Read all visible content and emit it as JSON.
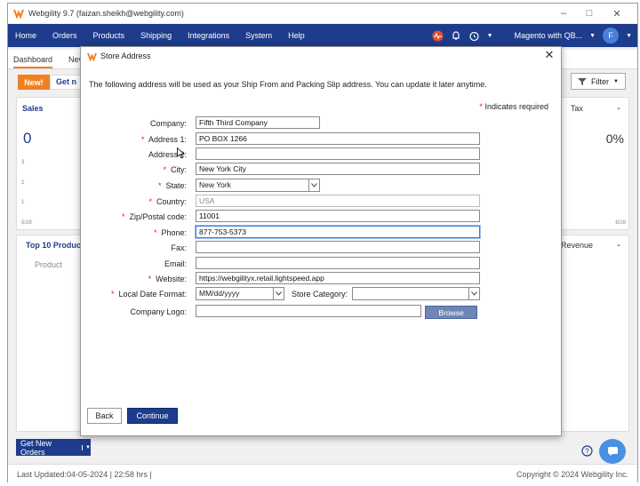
{
  "app": {
    "title": "Webgility 9.7 (faizan.sheikh@webgility.com)"
  },
  "nav": {
    "items": [
      "Home",
      "Orders",
      "Products",
      "Shipping",
      "Integrations",
      "System",
      "Help"
    ],
    "account": "Magento with QB...",
    "avatar_letter": "F"
  },
  "tabs": {
    "dashboard": "Dashboard",
    "partial": "Nev"
  },
  "toolbar": {
    "new_label": "New!",
    "get_label": "Get n",
    "filter_label": "Filter"
  },
  "sales": {
    "title": "Sales",
    "value": "0",
    "y_ticks": [
      "3",
      "2",
      "1"
    ],
    "x_start": "5/28",
    "x_end": "6/28"
  },
  "tax": {
    "title": "Tax",
    "value": "0%"
  },
  "top_products": {
    "title": "Top 10 Produc",
    "column": "Product",
    "right_label": "Revenue"
  },
  "get_new_orders": {
    "label": "Get New Orders"
  },
  "footer": {
    "last_updated": "Last Updated:04-05-2024 | 22:58 hrs |",
    "copyright": "Copyright © 2024 Webgility Inc."
  },
  "dialog": {
    "title": "Store Address",
    "intro": "The following address will be used as your Ship From and Packing Slip address. You can update it later anytime.",
    "required_note": "Indicates required",
    "required_mark": "*",
    "fields": {
      "company": {
        "label": "Company:",
        "value": "Fifth Third Company"
      },
      "address1": {
        "label": "Address 1:",
        "value": "PO BOX 1266"
      },
      "address2": {
        "label": "Address 2:",
        "value": ""
      },
      "city": {
        "label": "City:",
        "value": "New York City"
      },
      "state": {
        "label": "State:",
        "value": "New York"
      },
      "country": {
        "label": "Country:",
        "value": "USA"
      },
      "zip": {
        "label": "Zip/Postal code:",
        "value": "11001"
      },
      "phone": {
        "label": "Phone:",
        "value": "877-753-5373"
      },
      "fax": {
        "label": "Fax:",
        "value": ""
      },
      "email": {
        "label": "Email:",
        "value": ""
      },
      "website": {
        "label": "Website:",
        "value": "https://webgilityx.retail.lightspeed.app"
      },
      "date_format": {
        "label": "Local Date Format:",
        "value": "MM/dd/yyyy"
      },
      "store_category": {
        "label": "Store Category:",
        "value": ""
      },
      "logo": {
        "label": "Company Logo:",
        "value": ""
      }
    },
    "browse_label": "Browse",
    "back_label": "Back",
    "continue_label": "Continue"
  },
  "colors": {
    "nav_bg": "#1e3c8c",
    "accent_orange": "#f08020",
    "required_red": "#d9231c"
  }
}
